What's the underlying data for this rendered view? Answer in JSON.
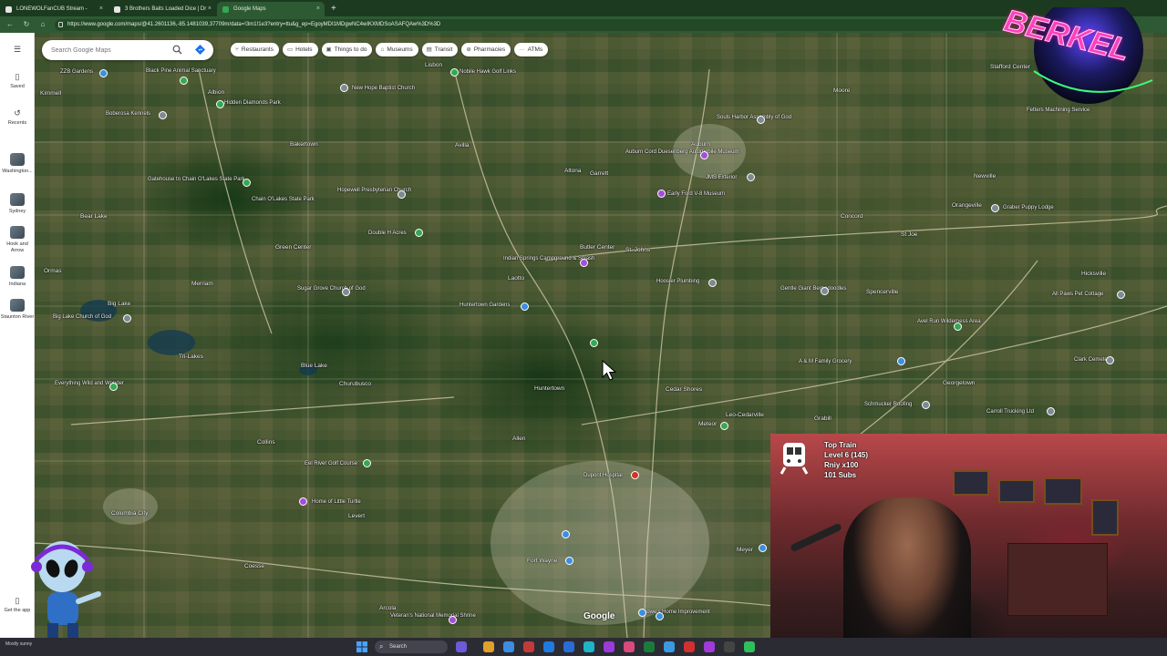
{
  "browser": {
    "tabs": [
      {
        "title": "LONEWOLFanCUB Stream -",
        "active": false,
        "color": "#e6e6e6"
      },
      {
        "title": "3 Brothers Baits Loaded Dice | Dr",
        "active": false,
        "color": "#e6e6e6"
      },
      {
        "title": "Google Maps",
        "active": true,
        "color": "#34a853"
      }
    ],
    "new_tab": "+",
    "close": "×",
    "url": "https://www.google.com/maps/@41.2601136,-85.1481039,37709m/data=!3m1!1e3?entry=ttu&g_ep=EgoyMDI1MDgwNC4wIKXMDSoASAFQAw%3D%3D"
  },
  "maps": {
    "search_placeholder": "Search Google Maps",
    "chips": [
      {
        "label": "Restaurants",
        "icon": "fork-knife-icon",
        "glyph": "🍴"
      },
      {
        "label": "Hotels",
        "icon": "bed-icon",
        "glyph": "▭"
      },
      {
        "label": "Things to do",
        "icon": "ticket-icon",
        "glyph": "▣"
      },
      {
        "label": "Museums",
        "icon": "museum-icon",
        "glyph": "⌂"
      },
      {
        "label": "Transit",
        "icon": "bus-icon",
        "glyph": "▤"
      },
      {
        "label": "Pharmacies",
        "icon": "pill-icon",
        "glyph": "⊕"
      },
      {
        "label": "ATMs",
        "icon": "atm-icon",
        "glyph": "···"
      }
    ],
    "rail": {
      "saved": "Saved",
      "recents": "Recents",
      "recent_places": [
        "Washington...",
        "Sydney",
        "Hook and Arrow",
        "Indiana",
        "Staunton River"
      ],
      "get_app": "Get the app"
    },
    "logo": "Google",
    "places": [
      "ZZB Gardens",
      "Black Pine Animal Sanctuary",
      "Albion",
      "Hidden Diamonds Park",
      "Kimmell",
      "Boberosa Kennels",
      "New Hope Baptist Church",
      "Nobile Hawk Golf Links",
      "Lisbon",
      "Moore",
      "Stafford Center",
      "Fetters Machining Service",
      "Bakertown",
      "Avilla",
      "Auburn Cord Duesenberg Automobile Museum",
      "Auburn",
      "Souls Harbor Assembly of God",
      "Garrett",
      "Altona",
      "JMS Exterior",
      "Early Ford V-8 Museum",
      "Newville",
      "Orangeville",
      "Graber Puppy Lodge",
      "Gatehouse to Chain O'Lakes State Park",
      "Chain O'Lakes State Park",
      "Hopewell Presbyterian Church",
      "Bear Lake",
      "Concord",
      "St Joe",
      "Green Center",
      "Double H Acres",
      "Butler Center",
      "St. Johns",
      "Indian Springs Campground & Splash",
      "Hoosier Plumbing",
      "Gentle Giant Bernedoodles",
      "Spencerville",
      "Hicksville",
      "All Paws Pet Cottage",
      "Ormas",
      "Merriam",
      "Sugar Grove Church of God",
      "Laotto",
      "Huntertown Gardens",
      "Big Lake",
      "Big Lake Church of God",
      "Avel Run Wilderness Area",
      "A & M Family Grocery",
      "Clark Cemetery",
      "Tri-Lakes",
      "Blue Lake",
      "Huntertown",
      "Cedar Shores",
      "Georgetown",
      "Schmucker Roofing",
      "Carroll Trucking Ltd",
      "Everything Wild and Wonder",
      "Churubusco",
      "Meteor",
      "Leo-Cedarville",
      "Grabill",
      "Collins",
      "Allen",
      "Eel River Golf Course",
      "Dupont Hospital",
      "Columbia City",
      "Home of Little Turtle",
      "Levert",
      "Coesse",
      "Arcola",
      "Veteran's National Memorial Shrine",
      "Lowe's Home Improvement",
      "Meyer",
      "Fort Wayne"
    ]
  },
  "overlay": {
    "channel_logo_text": "BERKEL",
    "train_title": "Top Train",
    "train_level": "Level 6  (145)",
    "train_multiplier": "Rniy x100",
    "train_subs": "101 Subs"
  },
  "taskbar": {
    "weather": "Mostly sunny",
    "search": "Search"
  },
  "colors": {
    "browser_chrome": "#2d5a33",
    "pin_gray": "#7d8a93",
    "pin_green": "#34a853",
    "pin_purple": "#a64dd8",
    "pin_blue": "#3b8fe0",
    "pin_red": "#d93025"
  }
}
